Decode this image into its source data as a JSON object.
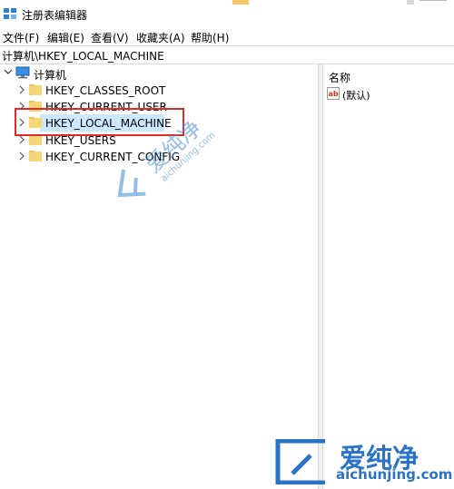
{
  "window": {
    "title": "注册表编辑器"
  },
  "menu": [
    {
      "label": "文件(F)"
    },
    {
      "label": "编辑(E)"
    },
    {
      "label": "查看(V)"
    },
    {
      "label": "收藏夹(A)"
    },
    {
      "label": "帮助(H)"
    }
  ],
  "address": "计算机\\HKEY_LOCAL_MACHINE",
  "tree": {
    "root": "计算机",
    "items": [
      {
        "label": "HKEY_CLASSES_ROOT"
      },
      {
        "label": "HKEY_CURRENT_USER"
      },
      {
        "label": "HKEY_LOCAL_MACHINE",
        "selected": true
      },
      {
        "label": "HKEY_USERS"
      },
      {
        "label": "HKEY_CURRENT_CONFIG"
      }
    ]
  },
  "list": {
    "header_name": "名称",
    "rows": [
      {
        "name": "(默认)",
        "icon": "string-value-icon"
      }
    ]
  },
  "watermark": {
    "brand": "爱纯净",
    "domain": "aichunjing.com"
  },
  "colors": {
    "highlight_border": "#e02b2b",
    "selection": "#cce8ff",
    "folder": "#f5d77a",
    "watermark": "#2a73c7"
  }
}
